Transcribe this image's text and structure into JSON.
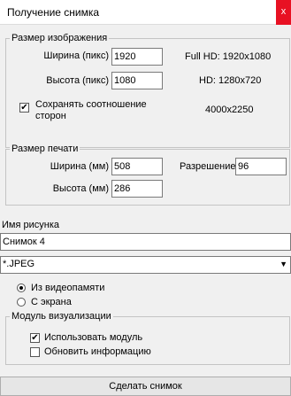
{
  "window": {
    "title": "Получение снимка",
    "close_glyph": "x"
  },
  "image_size": {
    "legend": "Размер изображения",
    "width_label": "Ширина (пикс)",
    "width_value": "1920",
    "height_label": "Высота (пикс)",
    "height_value": "1080",
    "keep_ratio_label_line1": "Сохранять соотношение",
    "keep_ratio_label_line2": "сторон",
    "keep_ratio_checked": true,
    "presets": [
      "Full HD: 1920x1080",
      "HD: 1280x720",
      "4000x2250"
    ]
  },
  "print_size": {
    "legend": "Размер печати",
    "width_label": "Ширина (мм)",
    "width_value": "508",
    "height_label": "Высота (мм)",
    "height_value": "286",
    "resolution_label": "Разрешение",
    "resolution_value": "96"
  },
  "picture": {
    "name_label": "Имя рисунка",
    "name_value": "Снимок 4",
    "format_value": "*.JPEG"
  },
  "source": {
    "options": [
      {
        "label": "Из видеопамяти",
        "selected": true
      },
      {
        "label": "С экрана",
        "selected": false
      }
    ]
  },
  "visualization": {
    "legend": "Модуль визуализации",
    "use_module_label": "Использовать модуль",
    "use_module_checked": true,
    "refresh_label": "Обновить информацию",
    "refresh_checked": false
  },
  "actions": {
    "capture_label": "Сделать снимок"
  }
}
